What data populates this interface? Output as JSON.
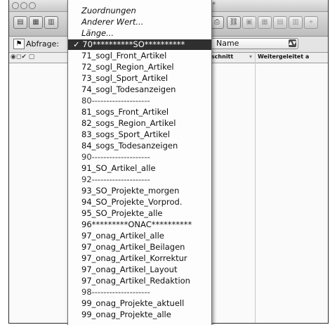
{
  "window": {
    "title": "****"
  },
  "query": {
    "label": "Abfrage:",
    "field_select": "Name"
  },
  "columns": {
    "abschnitt": "Abschnitt",
    "weitergeleitet": "Weitergeleitet a"
  },
  "menu": {
    "top_items": [
      "Zuordnungen",
      "Anderer Wert...",
      "Länge..."
    ],
    "items": [
      "70**********SO**********",
      "71_sogl_Front_Artikel",
      "72_sogl_Region_Artikel",
      "73_sogl_Sport_Artikel",
      "74_sogl_Todesanzeigen",
      "80--------------------",
      "81_sogs_Front_Artikel",
      "82_sogs_Region_Artikel",
      "83_sogs_Sport_Artikel",
      "84_sogs_Todesanzeigen",
      "90--------------------",
      "91_SO_Artikel_alle",
      "92--------------------",
      "93_SO_Projekte_morgen",
      "94_SO_Projekte_Vorprod.",
      "95_SO_Projekte_alle",
      "96*********ONAC**********",
      "97_onag_Artikel_alle",
      "97_onag_Artikel_Beilagen",
      "97_onag_Artikel_Korrektur",
      "97_onag_Artikel_Layout",
      "97_onag_Artikel_Redaktion",
      "98--------------------",
      "99_onag_Projekte_aktuell",
      "99_onag_Projekte_alle"
    ],
    "selected_index": 0,
    "checkmark": "✓"
  },
  "colors": {
    "selected_bg": "#2f2f2f",
    "selected_fg": "#ffffff"
  }
}
